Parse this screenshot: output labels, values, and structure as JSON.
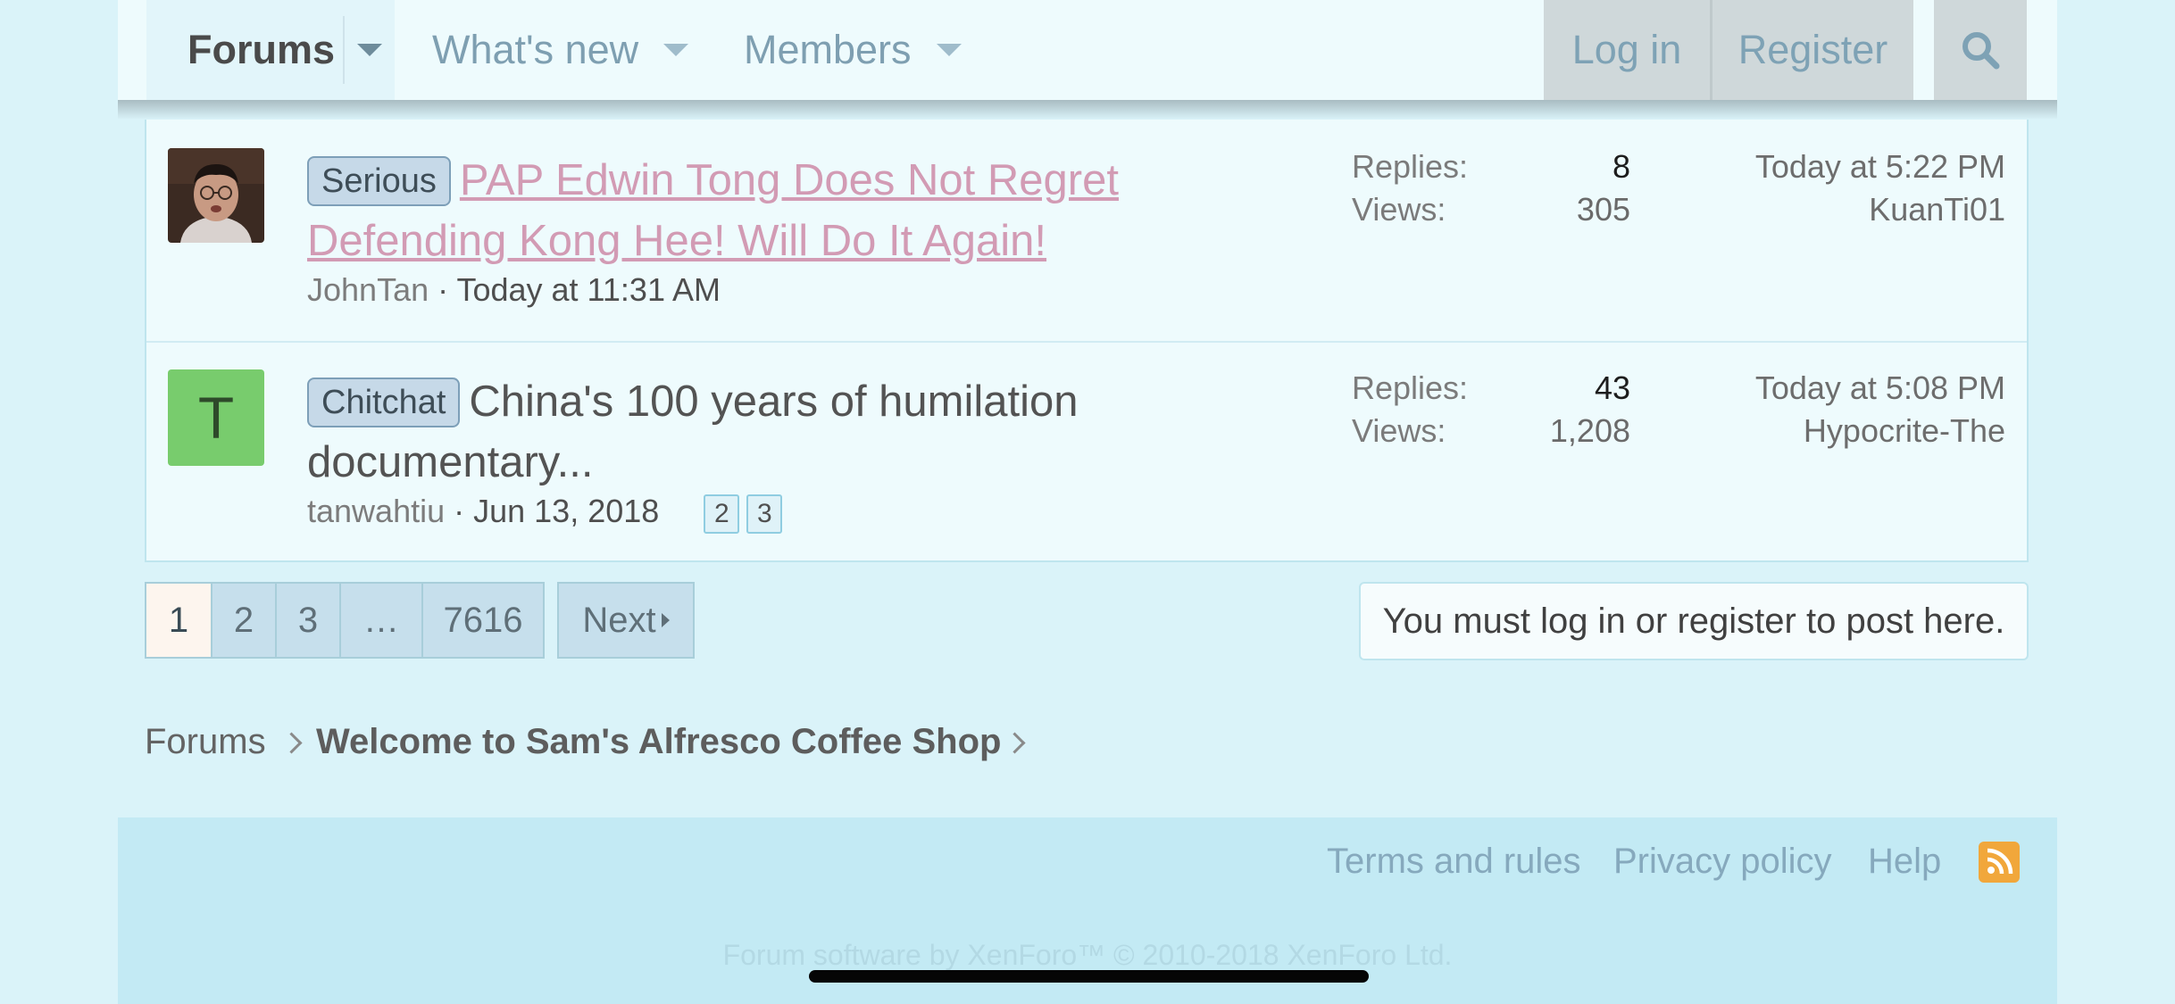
{
  "nav": {
    "tabs": [
      {
        "label": "Forums",
        "selected": true
      },
      {
        "label": "What's new"
      },
      {
        "label": "Members"
      }
    ],
    "login_label": "Log in",
    "register_label": "Register",
    "search_icon": "search-icon"
  },
  "threads": [
    {
      "prefix": "Serious",
      "title_line1": "PAP Edwin Tong Does Not Regret",
      "title_line2": "Defending Kong Hee! Will Do It Again!",
      "author": "JohnTan",
      "started": "Today at 11:31 AM",
      "pages": [],
      "replies_label": "Replies:",
      "replies": "8",
      "views_label": "Views:",
      "views": "305",
      "last_time": "Today at 5:22 PM",
      "last_user": "KuanTi01"
    },
    {
      "prefix": "Chitchat",
      "avatar_letter": "T",
      "title_line1": "China's 100 years of humilation",
      "title_line2": "documentary...",
      "author": "tanwahtiu",
      "started": "Jun 13, 2018",
      "pages": [
        "2",
        "3"
      ],
      "replies_label": "Replies:",
      "replies": "43",
      "views_label": "Views:",
      "views": "1,208",
      "last_time": "Today at 5:08 PM",
      "last_user": "Hypocrite-The"
    }
  ],
  "pagination": {
    "pages": [
      "1",
      "2",
      "3",
      "…",
      "7616"
    ],
    "current": "1",
    "next_label": "Next"
  },
  "notice": "You must log in or register to post here.",
  "breadcrumb": [
    "Forums",
    "Welcome to Sam's Alfresco Coffee Shop"
  ],
  "footer": {
    "links": [
      "Terms and rules",
      "Privacy policy",
      "Help"
    ],
    "rss_icon": "rss-icon",
    "copyright": "Forum software by XenForo™ © 2010-2018 XenForo Ltd."
  },
  "colors": {
    "page_bg": "#daf3f9",
    "nav_bg": "#eefbfd",
    "link_visited": "#d29bb4",
    "footer_bg": "#c3eaf4",
    "rss": "#f1a73b",
    "avatar_green": "#78cc6d"
  }
}
